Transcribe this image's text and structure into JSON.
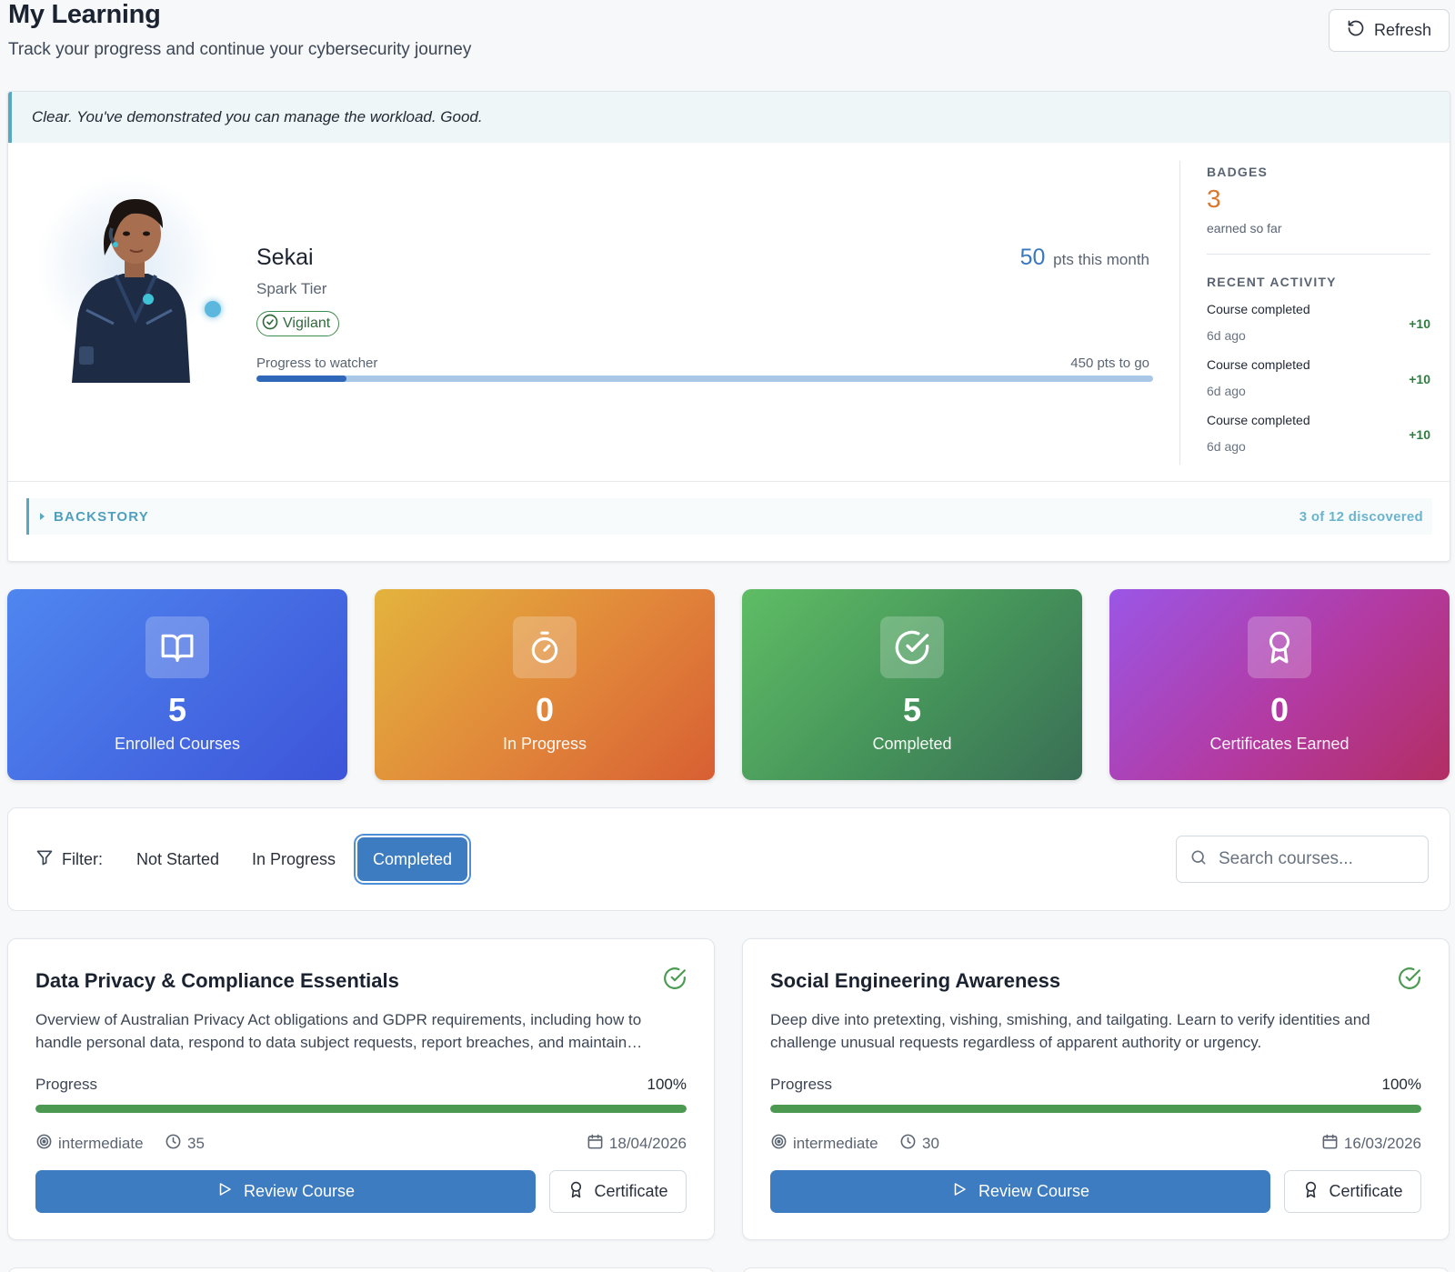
{
  "header": {
    "title": "My Learning",
    "subtitle": "Track your progress and continue your cybersecurity journey",
    "refresh_label": "Refresh"
  },
  "profile": {
    "quote": "Clear. You've demonstrated you can manage the workload. Good.",
    "name": "Sekai",
    "tier": "Spark Tier",
    "trait": "Vigilant",
    "points_value": "50",
    "points_label": "pts this month",
    "progress_label": "Progress to watcher",
    "progress_remaining": "450 pts to go",
    "progress_fraction": 0.1,
    "badges_heading": "BADGES",
    "badges_count": "3",
    "badges_note": "earned so far",
    "activity_heading": "RECENT ACTIVITY",
    "activity": [
      {
        "title": "Course completed",
        "time": "6d ago",
        "points": "+10"
      },
      {
        "title": "Course completed",
        "time": "6d ago",
        "points": "+10"
      },
      {
        "title": "Course completed",
        "time": "6d ago",
        "points": "+10"
      }
    ],
    "backstory_label": "BACKSTORY",
    "backstory_count": "3 of 12 discovered"
  },
  "stats": [
    {
      "value": "5",
      "label": "Enrolled Courses",
      "icon": "book-open-icon"
    },
    {
      "value": "0",
      "label": "In Progress",
      "icon": "timer-icon"
    },
    {
      "value": "5",
      "label": "Completed",
      "icon": "check-circle-icon"
    },
    {
      "value": "0",
      "label": "Certificates Earned",
      "icon": "award-icon"
    }
  ],
  "filter": {
    "label": "Filter:",
    "options": [
      "Not Started",
      "In Progress",
      "Completed"
    ],
    "active": "Completed",
    "search_placeholder": "Search courses..."
  },
  "courses": [
    {
      "title": "Data Privacy & Compliance Essentials",
      "description": "Overview of Australian Privacy Act obligations and GDPR requirements, including how to handle personal data, respond to data subject requests, report breaches, and maintain compliance across your organisation.",
      "progress_label": "Progress",
      "progress_value": "100%",
      "progress_fraction": 1.0,
      "level": "intermediate",
      "duration": "35",
      "date": "18/04/2026",
      "primary_action": "Review Course",
      "secondary_action": "Certificate"
    },
    {
      "title": "Social Engineering Awareness",
      "description": "Deep dive into pretexting, vishing, smishing, and tailgating. Learn to verify identities and challenge unusual requests regardless of apparent authority or urgency.",
      "progress_label": "Progress",
      "progress_value": "100%",
      "progress_fraction": 1.0,
      "level": "intermediate",
      "duration": "30",
      "date": "16/03/2026",
      "primary_action": "Review Course",
      "secondary_action": "Certificate"
    }
  ],
  "colors": {
    "primary": "#3d7cc0",
    "success": "#4c9a52",
    "accent_orange": "#d9782f",
    "teal": "#5aa7c2"
  }
}
